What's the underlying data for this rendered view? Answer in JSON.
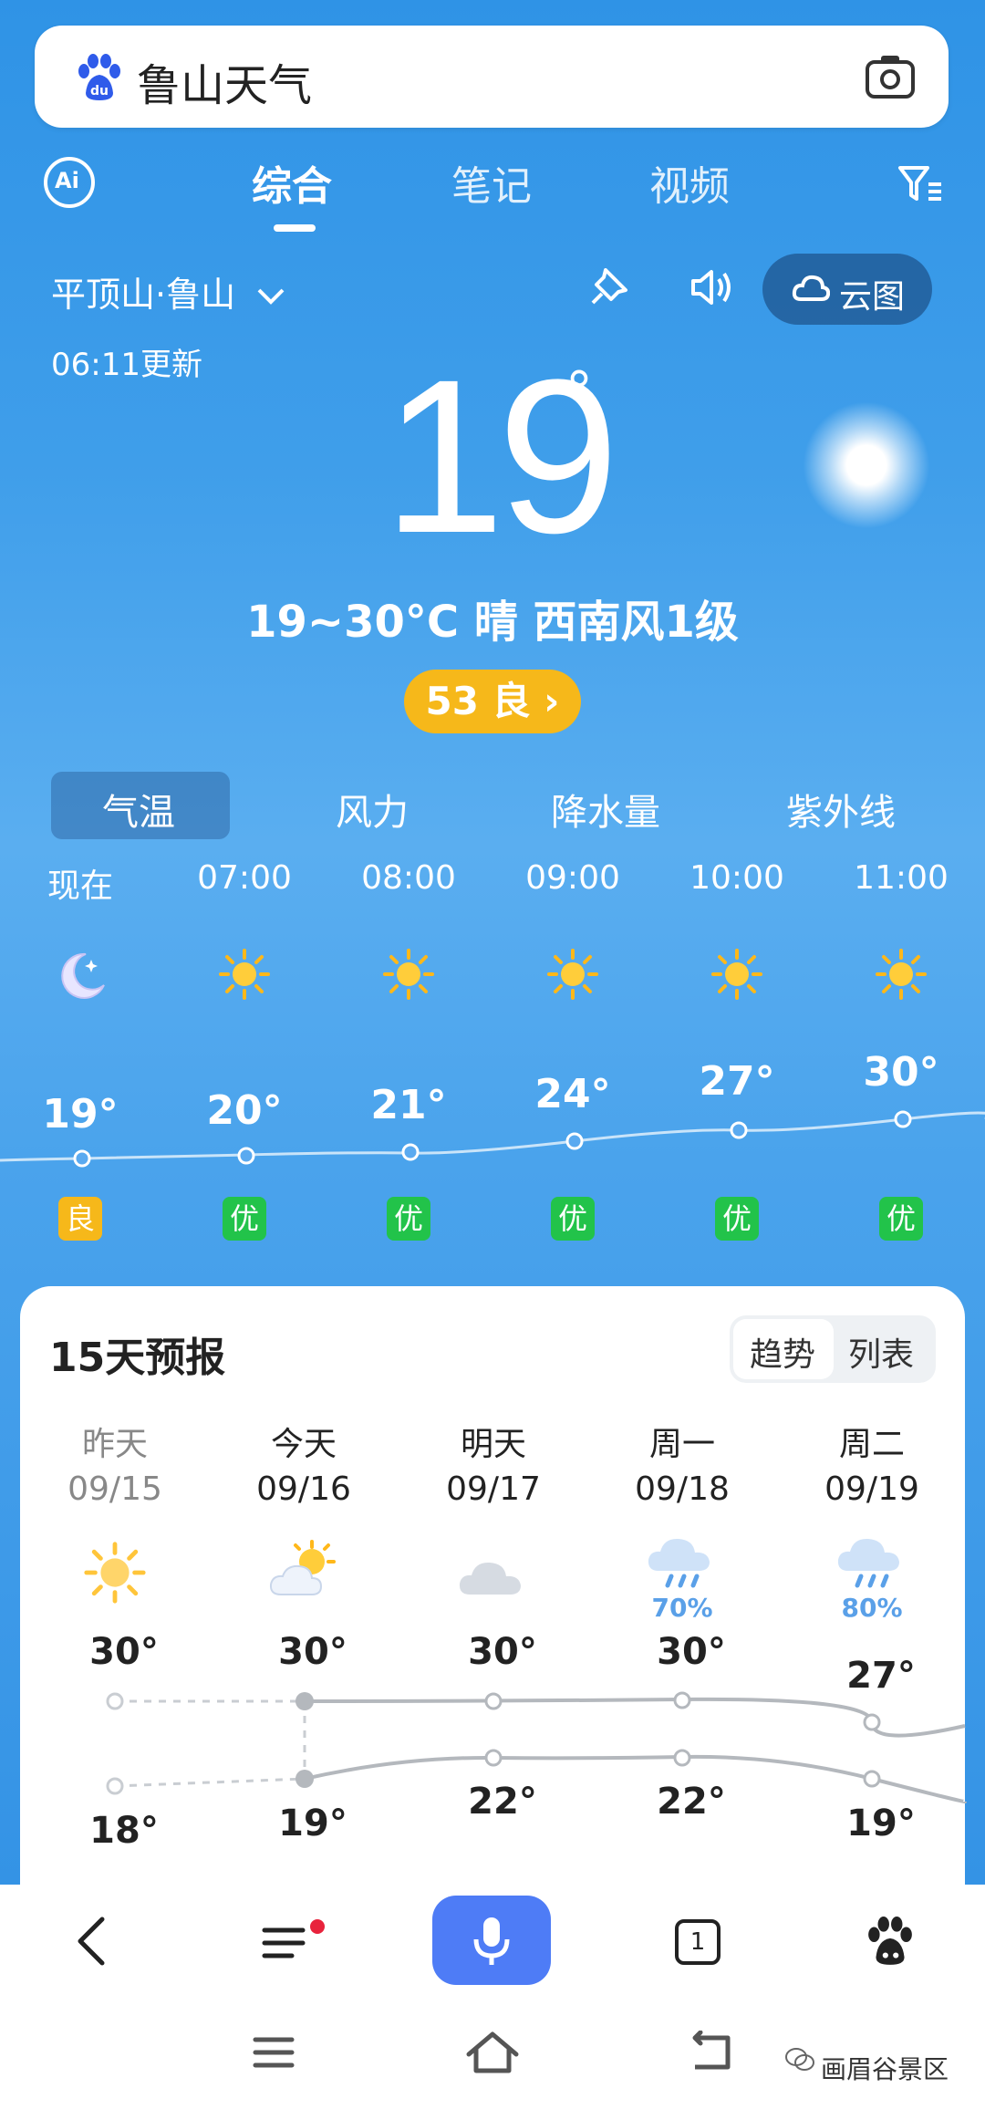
{
  "search": {
    "query": "鲁山天气",
    "logo_text": "du"
  },
  "tabs": [
    {
      "label": "综合"
    },
    {
      "label": "笔记"
    },
    {
      "label": "视频"
    }
  ],
  "ai_label": "Ai",
  "location": "平顶山·鲁山",
  "updated": "06:11更新",
  "cloud_button": "云图",
  "current": {
    "temp": "19",
    "deg": "°",
    "summary": "19~30°C 晴 西南风1级",
    "aqi": "53 良 ›"
  },
  "metric_tabs": [
    "气温",
    "风力",
    "降水量",
    "紫外线"
  ],
  "hourly": [
    {
      "time": "现在",
      "icon": "moon-icon",
      "temp": "19°",
      "quality": "良",
      "q_color": "#f6b81a"
    },
    {
      "time": "07:00",
      "icon": "sun-icon",
      "temp": "20°",
      "quality": "优",
      "q_color": "#22c34a"
    },
    {
      "time": "08:00",
      "icon": "sun-icon",
      "temp": "21°",
      "quality": "优",
      "q_color": "#22c34a"
    },
    {
      "time": "09:00",
      "icon": "sun-icon",
      "temp": "24°",
      "quality": "优",
      "q_color": "#22c34a"
    },
    {
      "time": "10:00",
      "icon": "sun-icon",
      "temp": "27°",
      "quality": "优",
      "q_color": "#22c34a"
    },
    {
      "time": "11:00",
      "icon": "sun-icon",
      "temp": "30°",
      "quality": "优",
      "q_color": "#22c34a"
    }
  ],
  "forecast": {
    "title": "15天预报",
    "toggle": [
      "趋势",
      "列表"
    ],
    "days": [
      {
        "day": "昨天",
        "date": "09/15",
        "icon": "sun-icon",
        "rain": "",
        "high": "30°",
        "low": "18°",
        "past": true
      },
      {
        "day": "今天",
        "date": "09/16",
        "icon": "sun-cloud-icon",
        "rain": "",
        "high": "30°",
        "low": "19°",
        "past": false
      },
      {
        "day": "明天",
        "date": "09/17",
        "icon": "cloud-icon",
        "rain": "",
        "high": "30°",
        "low": "22°",
        "past": false
      },
      {
        "day": "周一",
        "date": "09/18",
        "icon": "rain-cloud-icon",
        "rain": "70%",
        "high": "30°",
        "low": "22°",
        "past": false
      },
      {
        "day": "周二",
        "date": "09/19",
        "icon": "rain-cloud-icon",
        "rain": "80%",
        "high": "27°",
        "low": "19°",
        "past": false
      }
    ]
  },
  "nav": {
    "tab_count": "1",
    "mic_icon": "microphone-icon"
  },
  "watermark": "画眉谷景区"
}
